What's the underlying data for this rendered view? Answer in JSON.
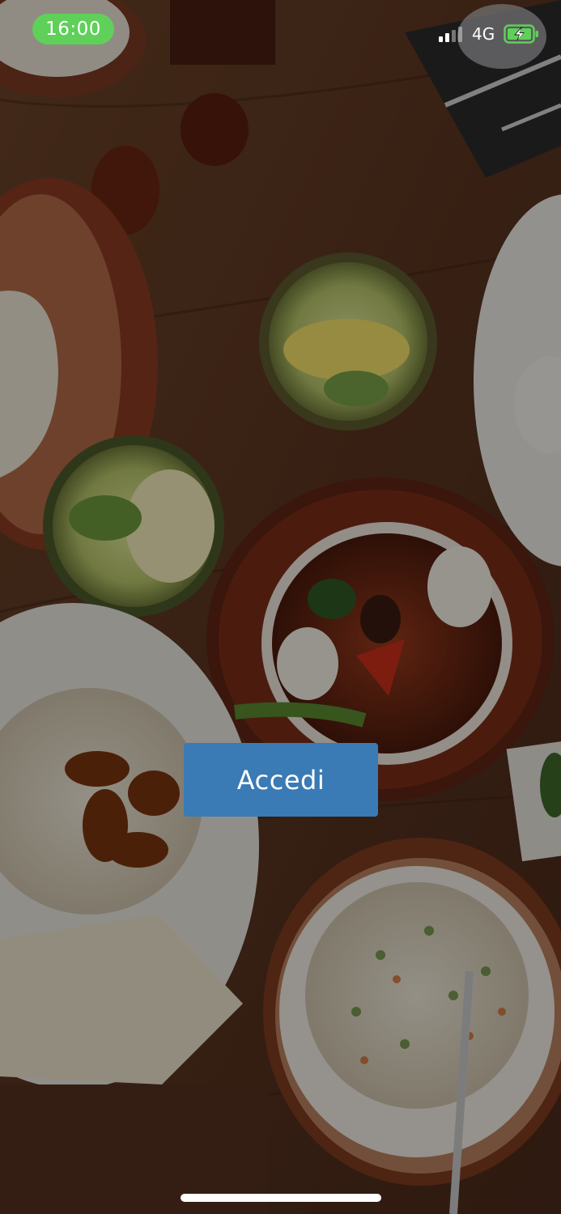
{
  "status_bar": {
    "time": "16:00",
    "network": "4G",
    "signal_bars_active": 2,
    "signal_bars_total": 4,
    "battery_state": "charging",
    "time_pill_color": "#5fd05a",
    "battery_color": "#5fd05a"
  },
  "background": {
    "icon": "food-table-photo"
  },
  "login": {
    "label": "Accedi",
    "color": "#3a7ab5"
  }
}
